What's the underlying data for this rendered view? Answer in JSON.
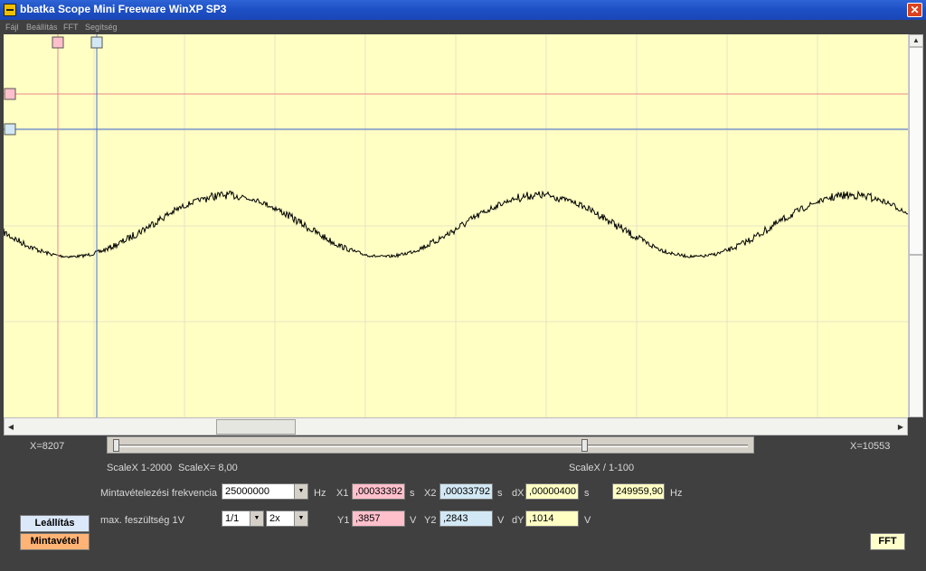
{
  "window": {
    "title": "bbatka Scope Mini Freeware WinXP SP3",
    "close_glyph": "✕",
    "icon": "app-icon"
  },
  "menu": [
    "Fájl",
    "Beállítás",
    "FFT",
    "Segítség"
  ],
  "colors": {
    "plot_bg": "#ffffc4",
    "grid": "#e4e4c4",
    "cursor1": "#e88888",
    "cursor2": "#4a70d0",
    "cursor1_marker": "#ffc0cc",
    "cursor2_marker": "#d2e8f4",
    "signal": "#000000"
  },
  "status": {
    "x_left": "X=8207",
    "x_right": "X=10553",
    "scalex_range": "ScaleX 1-2000",
    "scalex_value": "ScaleX= 8,00",
    "scalex_div": "ScaleX / 1-100"
  },
  "sliders": {
    "scalex_level": 0.0,
    "scalex_div_level": 0.74
  },
  "sampling": {
    "label": "Mintavételezési frekvencia",
    "value": "25000000",
    "unit": "Hz"
  },
  "max_voltage": {
    "label": "max. feszültség  1V",
    "ratio": "1/1",
    "gain": "2x"
  },
  "cursors": {
    "x1_label": "X1",
    "x1": ",00033392",
    "x1_unit": "s",
    "x2_label": "X2",
    "x2": ",00033792",
    "x2_unit": "s",
    "dx_label": "dX",
    "dx": ",00000400",
    "dx_unit": "s",
    "freq": "249959,90",
    "freq_unit": "Hz",
    "y1_label": "Y1",
    "y1": ",3857",
    "y1_unit": "V",
    "y2_label": "Y2",
    "y2": ",2843",
    "y2_unit": "V",
    "dy_label": "dY",
    "dy": ",1014",
    "dy_unit": "V"
  },
  "buttons": {
    "stop": "Leállítás",
    "sample": "Mintavétel",
    "fft": "FFT"
  }
}
